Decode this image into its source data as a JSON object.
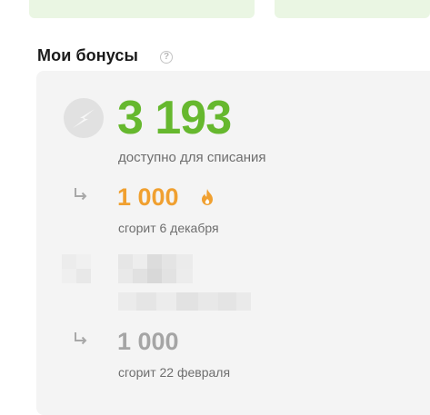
{
  "section": {
    "title": "Мои бонусы",
    "help_glyph": "?"
  },
  "balance": {
    "amount": "3 193",
    "caption": "доступно для списания"
  },
  "expiring": [
    {
      "amount": "1 000",
      "caption": "сгорит 6 декабря",
      "color": "#f0a030",
      "icon": "fire-icon"
    },
    {
      "amount": "1 000",
      "caption": "сгорит 22 февраля",
      "color": "#a5a5a5"
    }
  ],
  "colors": {
    "accent_green": "#66b82e",
    "panel_bg": "#f4f4f4",
    "top_card_bg": "#eaf6e3"
  },
  "icons": {
    "balance": "lightning-bolt-icon",
    "sub_item": "return-arrow-icon",
    "help": "question-circle-icon"
  }
}
